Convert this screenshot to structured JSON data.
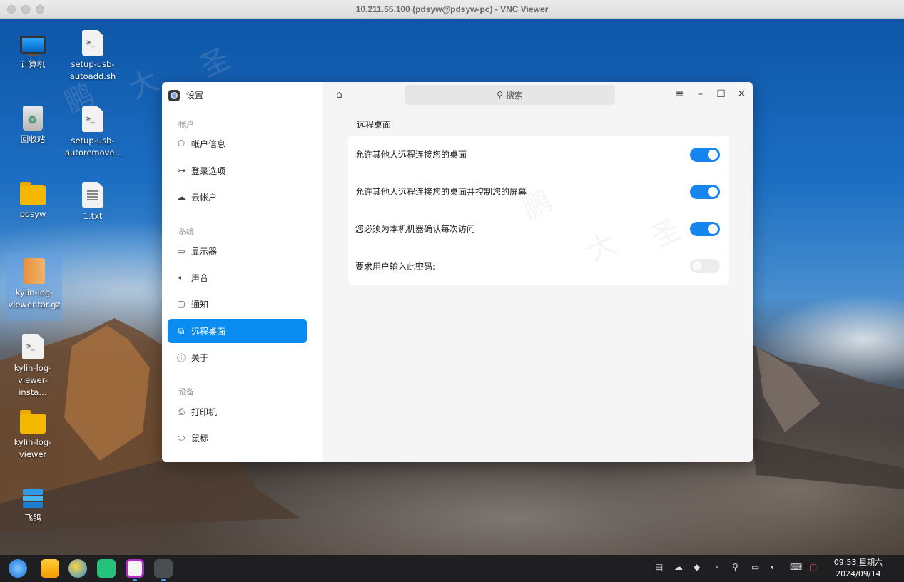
{
  "vnc": {
    "title": "10.211.55.100 (pdsyw@pdsyw-pc) - VNC Viewer"
  },
  "desktop_icons": [
    {
      "label": "计算机",
      "icon": "computer-icon"
    },
    {
      "label": "setup-usb-autoadd.sh",
      "icon": "script-file-icon"
    },
    {
      "label": "回收站",
      "icon": "trash-icon"
    },
    {
      "label": "setup-usb-autoremove…",
      "icon": "script-file-icon"
    },
    {
      "label": "pdsyw",
      "icon": "folder-icon"
    },
    {
      "label": "1.txt",
      "icon": "text-file-icon"
    },
    {
      "label": "kylin-log-viewer.tar.gz",
      "icon": "archive-icon"
    },
    {
      "label": "kylin-log-viewer-insta…",
      "icon": "script-file-icon"
    },
    {
      "label": "kylin-log-viewer",
      "icon": "folder-icon"
    },
    {
      "label": "飞鸽",
      "icon": "feige-app-icon"
    }
  ],
  "settings": {
    "app_title": "设置",
    "search_placeholder": "搜索",
    "groups": {
      "account": "帐户",
      "system": "系统",
      "device": "设备"
    },
    "nav": {
      "account_info": "帐户信息",
      "login_options": "登录选项",
      "cloud_account": "云帐户",
      "display": "显示器",
      "sound": "声音",
      "notify": "通知",
      "remote_desktop": "远程桌面",
      "about": "关于",
      "printer": "打印机",
      "mouse": "鼠标"
    },
    "section_title": "远程桌面",
    "options": [
      {
        "label": "允许其他人远程连接您的桌面",
        "enabled": true
      },
      {
        "label": "允许其他人远程连接您的桌面并控制您的屏幕",
        "enabled": true
      },
      {
        "label": "您必须为本机机器确认每次访问",
        "enabled": true
      },
      {
        "label": "要求用户输入此密码:",
        "enabled": false
      }
    ]
  },
  "taskbar": {
    "time": "09:53 星期六",
    "date": "2024/09/14"
  },
  "colors": {
    "accent": "#0b8cf0",
    "toggle_on": "#1685f0"
  }
}
